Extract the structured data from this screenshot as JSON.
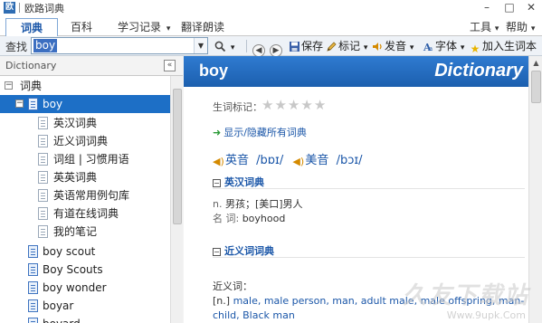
{
  "window": {
    "title": "欧路词典",
    "app_icon": "app-logo-icon",
    "controls": {
      "minimize": "–",
      "maximize": "□",
      "close": "✕"
    }
  },
  "menu": {
    "tabs": [
      {
        "label": "词典",
        "active": true
      },
      {
        "label": "百科"
      },
      {
        "label": "学习记录",
        "has_dropdown": true
      },
      {
        "label": "翻译朗读"
      }
    ],
    "right": [
      {
        "label": "工具",
        "has_dropdown": true
      },
      {
        "label": "帮助",
        "has_dropdown": true
      }
    ],
    "dropdown_glyph": "▾"
  },
  "toolbar": {
    "search_label": "查找",
    "search_value": "boy",
    "dropdown_glyph": "▼",
    "search_icon": "magnifier-icon",
    "back_icon": "back-arrow-icon",
    "forward_icon": "forward-arrow-icon",
    "save_label": "保存",
    "mark_label": "标记",
    "speak_label": "发音",
    "font_label": "字体",
    "add_wordbook_label": "加入生词本"
  },
  "left_pane": {
    "header": "Dictionary",
    "collapse_glyph": "«",
    "tree": [
      {
        "label": "词典",
        "level": 0,
        "expander": "−"
      },
      {
        "label": "boy",
        "level": 1,
        "expander": "−",
        "selected": true
      },
      {
        "label": "英汉词典",
        "level": 2
      },
      {
        "label": "近义词词典",
        "level": 2
      },
      {
        "label": "词组 | 习惯用语",
        "level": 2
      },
      {
        "label": "英英词典",
        "level": 2
      },
      {
        "label": "英语常用例句库",
        "level": 2
      },
      {
        "label": "有道在线词典",
        "level": 2
      },
      {
        "label": "我的笔记",
        "level": 2
      },
      {
        "label": "boy scout",
        "level": 1
      },
      {
        "label": "Boy Scouts",
        "level": 1
      },
      {
        "label": "boy wonder",
        "level": 1
      },
      {
        "label": "boyar",
        "level": 1
      },
      {
        "label": "boyard",
        "level": 1
      }
    ]
  },
  "entry": {
    "word": "boy",
    "brand": "Dictionary",
    "rating_label": "生词标记：",
    "rating": 0,
    "rating_max": 5,
    "toggle_link": "显示/隐藏所有词典",
    "pron_uk_label": "英音",
    "pron_uk": "/bɒɪ/",
    "pron_us_label": "美音",
    "pron_us": "/bɔɪ/",
    "sections": {
      "ec_title": "英汉词典",
      "ec_defs": [
        {
          "pos": "n.",
          "text": "男孩；[美口]男人"
        },
        {
          "pos": "名  词:",
          "text": "boyhood"
        }
      ],
      "syn_title": "近义词词典",
      "syn_label": "近义词：",
      "syn_pos": "[n.]",
      "syn_text": "male, male person, man, adult male, male offspring, man-child, Black man"
    },
    "colors": {
      "banner": "#1c5fae",
      "link": "#1a56a8",
      "selection": "#1d6fc6"
    }
  },
  "watermark": {
    "main": "久友下载站",
    "sub": "Www.9upk.Com"
  }
}
